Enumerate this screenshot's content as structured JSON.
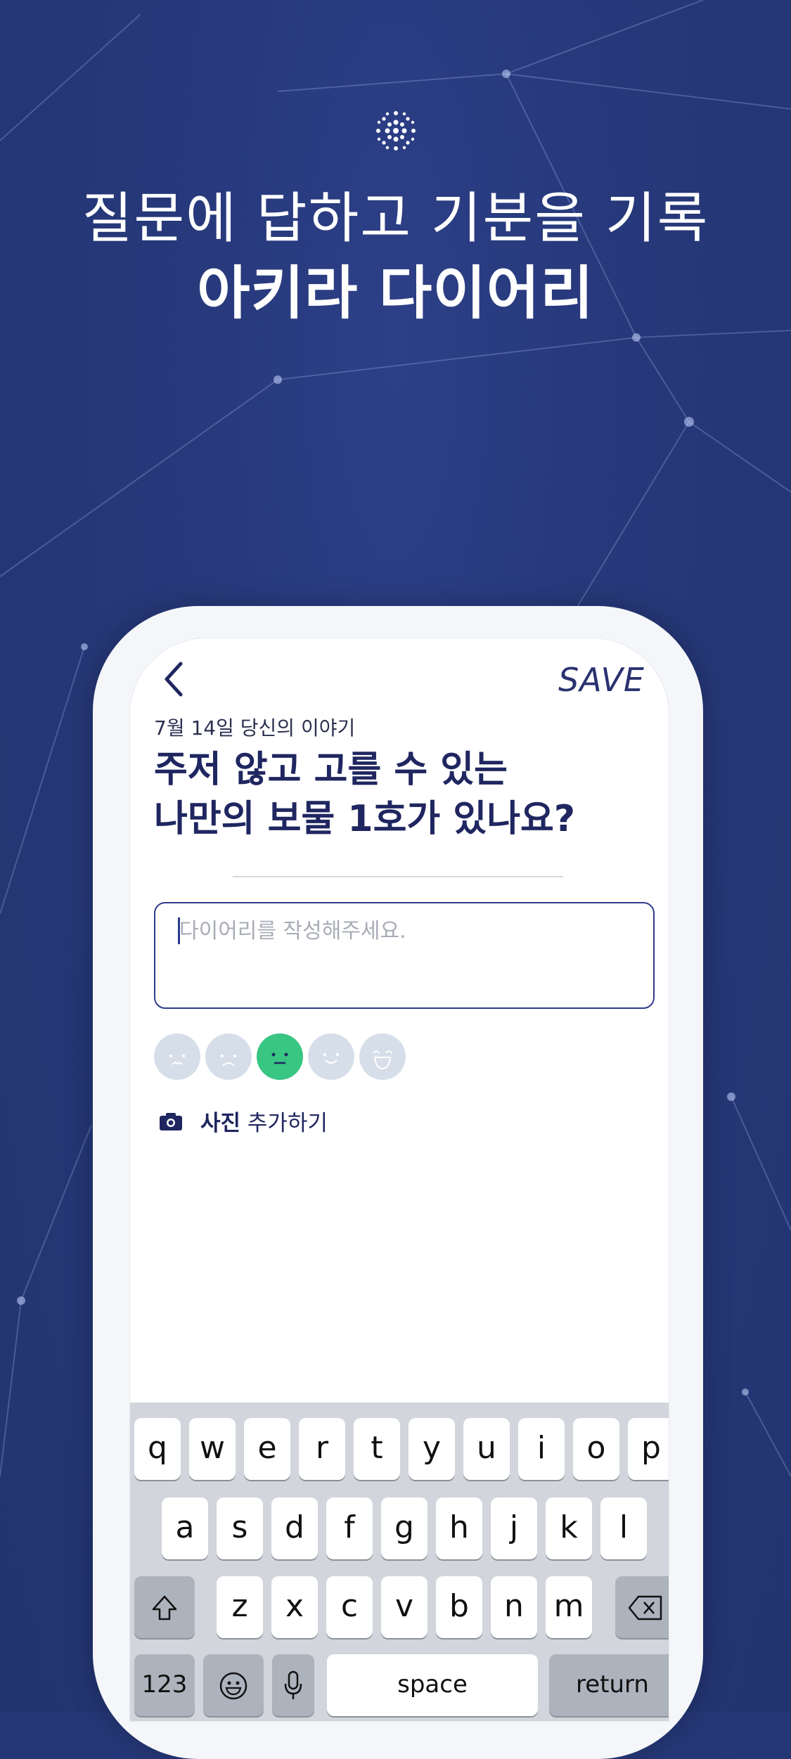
{
  "headline": {
    "line1": "질문에 답하고 기분을 기록",
    "line2": "아키라 다이어리"
  },
  "screen": {
    "save_label": "SAVE",
    "date_label": "7월 14일 당신의 이야기",
    "question_line1": "주저 않고 고를 수 있는",
    "question_line2": "나만의 보물 1호가 있나요?",
    "diary_placeholder": "다이어리를 작성해주세요.",
    "moods": [
      "very-sad",
      "sad",
      "neutral",
      "happy",
      "very-happy"
    ],
    "selected_mood": "neutral",
    "photo_label_bold": "사진",
    "photo_label_rest": " 추가하기"
  },
  "keyboard": {
    "row1": [
      "q",
      "w",
      "e",
      "r",
      "t",
      "y",
      "u",
      "i",
      "o",
      "p"
    ],
    "row2": [
      "a",
      "s",
      "d",
      "f",
      "g",
      "h",
      "j",
      "k",
      "l"
    ],
    "row3": [
      "z",
      "x",
      "c",
      "v",
      "b",
      "n",
      "m"
    ],
    "numbers_label": "123",
    "space_label": "space",
    "return_label": "return"
  },
  "colors": {
    "background": "#263879",
    "accent": "#2f3a8a",
    "mood_selected": "#39c582",
    "mood_default": "#d6dfe9"
  }
}
